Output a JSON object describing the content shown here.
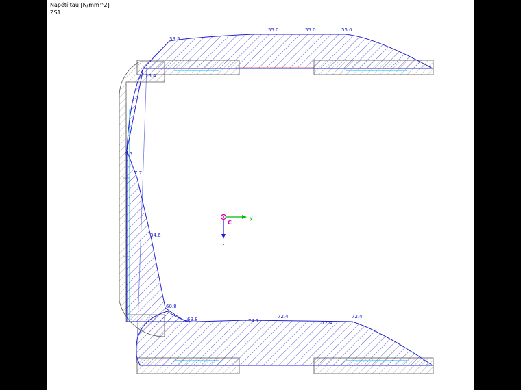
{
  "header": {
    "title": "Napětí tau [N/mm^2]",
    "load_case": "ZS1"
  },
  "colors": {
    "stress_line": "#2222cc",
    "section_outline": "#555555",
    "centerline_hint": "#33ccee",
    "red_edge": "#ff3344",
    "axis_y": "#00bb00",
    "axis_z": "#1a1ae0",
    "centroid": "#cc00aa"
  },
  "axes": {
    "y_label": "y",
    "z_label": "z",
    "centroid_label": "C"
  },
  "stress_labels": {
    "top_flange": [
      "39.5",
      "55.0",
      "55.0",
      "55.0"
    ],
    "top_corner": "25.4",
    "web": [
      "0.5",
      "7.7",
      "34.6",
      "60.8"
    ],
    "bottom_flange": [
      "69.8",
      "74.7",
      "72.4",
      "72.4",
      "72.4"
    ]
  }
}
